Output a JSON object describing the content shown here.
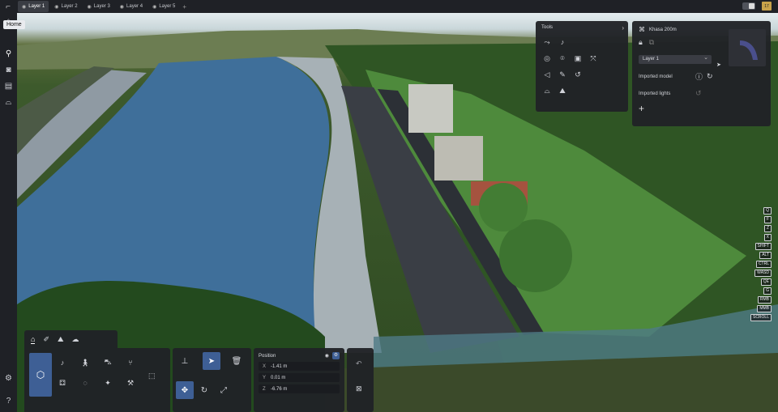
{
  "tabs": [
    {
      "label": "Layer 1",
      "active": true
    },
    {
      "label": "Layer 2",
      "active": false
    },
    {
      "label": "Layer 3",
      "active": false
    },
    {
      "label": "Layer 4",
      "active": false
    },
    {
      "label": "Layer 5",
      "active": false
    }
  ],
  "topright": {
    "calendar_day": "17"
  },
  "sidebar": {
    "tooltip": "Home"
  },
  "tools_panel": {
    "title": "Tools"
  },
  "props_panel": {
    "name": "Khasa 200m",
    "layer_select": "Layer 1",
    "imported_model_label": "Imported model",
    "imported_lights_label": "Imported lights"
  },
  "keys": [
    "Q",
    "F",
    "Z",
    "X",
    "SHIFT",
    "ALT",
    "CTRL",
    "WASD",
    "QE",
    "G",
    "RMB",
    "MMB",
    "SCROLL"
  ],
  "position": {
    "title": "Position",
    "x_label": "X",
    "x": "-1.41 m",
    "y_label": "Y",
    "y": "0.01 m",
    "z_label": "Z",
    "z": "-6.76 m"
  },
  "colors": {
    "accent": "#3e5f95",
    "panel": "#202227",
    "water": "#3f6f9a",
    "grass": "#4a7a3a"
  }
}
